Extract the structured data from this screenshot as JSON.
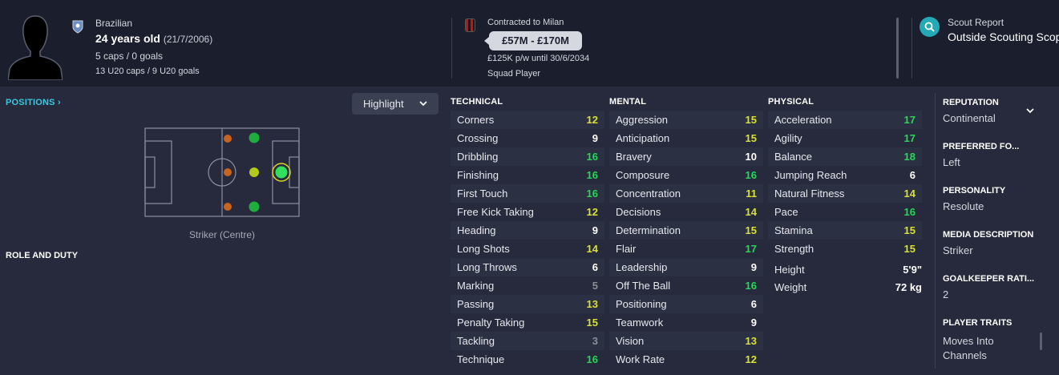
{
  "colors": {
    "green": "#29d65a",
    "yellow": "#d9e038",
    "white": "#ffffff",
    "grey": "#8a8e99",
    "accent": "#3cc8e0"
  },
  "header": {
    "nationality": "Brazilian",
    "age": "24 years old",
    "dob": "(21/7/2006)",
    "caps": "5 caps / 0 goals",
    "u20_caps": "13 U20 caps / 9 U20 goals",
    "contract_label": "Contracted to Milan",
    "value_range": "£57M - £170M",
    "wage": "£125K p/w until 30/6/2034",
    "squad_status": "Squad Player",
    "scout_title": "Scout Report",
    "scout_value": "Outside Scouting Scope"
  },
  "positions": {
    "link_label": "POSITIONS",
    "highlight_label": "Highlight",
    "pitch_caption": "Striker (Centre)",
    "role_title": "ROLE AND DUTY"
  },
  "technical": {
    "title": "TECHNICAL",
    "attrs": [
      {
        "name": "Corners",
        "value": "12",
        "tone": "yellow"
      },
      {
        "name": "Crossing",
        "value": "9",
        "tone": "white"
      },
      {
        "name": "Dribbling",
        "value": "16",
        "tone": "green"
      },
      {
        "name": "Finishing",
        "value": "16",
        "tone": "green"
      },
      {
        "name": "First Touch",
        "value": "16",
        "tone": "green"
      },
      {
        "name": "Free Kick Taking",
        "value": "12",
        "tone": "yellow"
      },
      {
        "name": "Heading",
        "value": "9",
        "tone": "white"
      },
      {
        "name": "Long Shots",
        "value": "14",
        "tone": "yellow"
      },
      {
        "name": "Long Throws",
        "value": "6",
        "tone": "white"
      },
      {
        "name": "Marking",
        "value": "5",
        "tone": "grey"
      },
      {
        "name": "Passing",
        "value": "13",
        "tone": "yellow"
      },
      {
        "name": "Penalty Taking",
        "value": "15",
        "tone": "yellow"
      },
      {
        "name": "Tackling",
        "value": "3",
        "tone": "grey"
      },
      {
        "name": "Technique",
        "value": "16",
        "tone": "green"
      }
    ]
  },
  "mental": {
    "title": "MENTAL",
    "attrs": [
      {
        "name": "Aggression",
        "value": "15",
        "tone": "yellow"
      },
      {
        "name": "Anticipation",
        "value": "15",
        "tone": "yellow"
      },
      {
        "name": "Bravery",
        "value": "10",
        "tone": "white"
      },
      {
        "name": "Composure",
        "value": "16",
        "tone": "green"
      },
      {
        "name": "Concentration",
        "value": "11",
        "tone": "yellow"
      },
      {
        "name": "Decisions",
        "value": "14",
        "tone": "yellow"
      },
      {
        "name": "Determination",
        "value": "15",
        "tone": "yellow"
      },
      {
        "name": "Flair",
        "value": "17",
        "tone": "green"
      },
      {
        "name": "Leadership",
        "value": "9",
        "tone": "white"
      },
      {
        "name": "Off The Ball",
        "value": "16",
        "tone": "green"
      },
      {
        "name": "Positioning",
        "value": "6",
        "tone": "white"
      },
      {
        "name": "Teamwork",
        "value": "9",
        "tone": "white"
      },
      {
        "name": "Vision",
        "value": "13",
        "tone": "yellow"
      },
      {
        "name": "Work Rate",
        "value": "12",
        "tone": "yellow"
      }
    ]
  },
  "physical": {
    "title": "PHYSICAL",
    "attrs": [
      {
        "name": "Acceleration",
        "value": "17",
        "tone": "green"
      },
      {
        "name": "Agility",
        "value": "17",
        "tone": "green"
      },
      {
        "name": "Balance",
        "value": "18",
        "tone": "green"
      },
      {
        "name": "Jumping Reach",
        "value": "6",
        "tone": "white"
      },
      {
        "name": "Natural Fitness",
        "value": "14",
        "tone": "yellow"
      },
      {
        "name": "Pace",
        "value": "16",
        "tone": "green"
      },
      {
        "name": "Stamina",
        "value": "15",
        "tone": "yellow"
      },
      {
        "name": "Strength",
        "value": "15",
        "tone": "yellow"
      }
    ],
    "height_label": "Height",
    "height_value": "5'9\"",
    "weight_label": "Weight",
    "weight_value": "72 kg"
  },
  "sidebar": {
    "reputation_title": "REPUTATION",
    "reputation_value": "Continental",
    "foot_title": "PREFERRED FO...",
    "foot_value": "Left",
    "personality_title": "PERSONALITY",
    "personality_value": "Resolute",
    "media_title": "MEDIA DESCRIPTION",
    "media_value": "Striker",
    "gk_title": "GOALKEEPER RATI...",
    "gk_value": "2",
    "traits_title": "PLAYER TRAITS",
    "traits_value_1": "Moves Into",
    "traits_value_2": "Channels"
  }
}
